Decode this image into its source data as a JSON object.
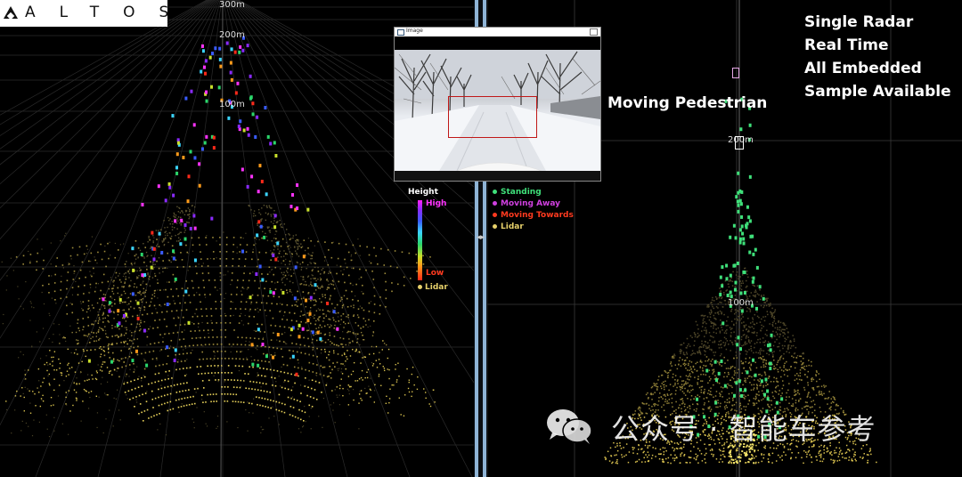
{
  "logo": {
    "text": "ALTOS"
  },
  "left_view": {
    "distance_labels": [
      "300m",
      "200m",
      "100m"
    ]
  },
  "right_view": {
    "distance_labels": [
      "200m",
      "100m"
    ]
  },
  "image_window": {
    "title": "Image"
  },
  "height_legend": {
    "title": "Height",
    "high_label": "High",
    "low_label": "Low",
    "lidar_label": "Lidar",
    "colors": {
      "high": "#ff33ff",
      "low": "#ff3a1f",
      "lidar": "#e6d06a"
    }
  },
  "class_legend": {
    "items": [
      {
        "label": "Standing",
        "color": "#3fe07a"
      },
      {
        "label": "Moving Away",
        "color": "#d040e0"
      },
      {
        "label": "Moving Towards",
        "color": "#ff3a1f"
      },
      {
        "label": "Lidar",
        "color": "#e6d06a"
      }
    ]
  },
  "features": [
    "Single Radar",
    "Real Time",
    "All Embedded",
    "Sample Available"
  ],
  "pedestrian_label": "Moving Pedestrian",
  "watermark": {
    "text": "公众号 · 智能车参考",
    "icon": "wechat-icon"
  }
}
